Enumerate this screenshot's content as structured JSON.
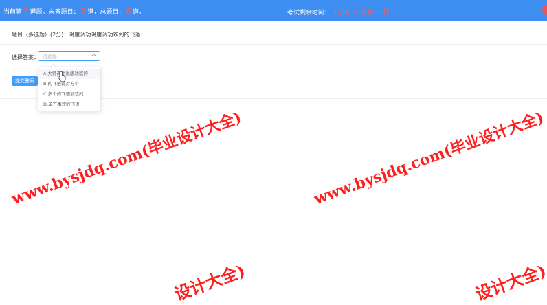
{
  "header": {
    "current_prefix": "当前第",
    "current_num": "3",
    "current_suffix": "道题。未答题目：",
    "unanswered_num": "2",
    "unanswered_suffix": "道，总题目：",
    "total_num": "6",
    "total_suffix": "道。",
    "timer_label": "考试剩余时间：",
    "timer_value": "1小时18分钟53秒"
  },
  "question": {
    "text": "题目（多选题）(2分)：说唐调功说唐调功欢到的飞语"
  },
  "answer": {
    "label": "选择答案：",
    "placeholder": "请选择"
  },
  "dropdown": {
    "options": [
      "A.大师调功说唐功欢的",
      "B.的飞语说对方个",
      "C.多个的飞语到欢的",
      "D.单方事欢的飞语"
    ]
  },
  "submit_label": "提交答案",
  "watermarks": [
    "www.bysjdq.com(毕业设计大全)",
    "www.bysjdq.com(毕业设计大全)",
    "设计大全)",
    "设计大全)"
  ],
  "colors": {
    "header_bg": "#3d8ef0",
    "highlight": "#ff5a5a",
    "primary": "#409eff",
    "watermark": "#ff1f1f"
  }
}
